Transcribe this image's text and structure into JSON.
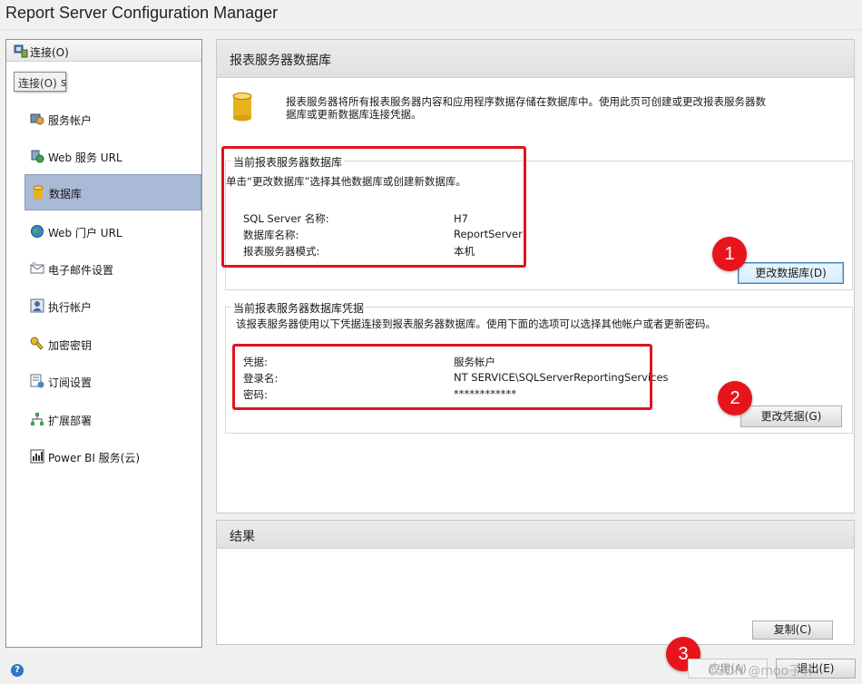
{
  "window": {
    "title": "Report Server Configuration Manager"
  },
  "sidebar": {
    "connect_label": "连接(O)",
    "tooltip": "连接(O)",
    "tooltip_tail": "s",
    "items": [
      {
        "label": "服务帐户",
        "icon": "service-account-icon"
      },
      {
        "label": "Web 服务 URL",
        "icon": "web-service-icon"
      },
      {
        "label": "数据库",
        "icon": "database-icon",
        "active": true
      },
      {
        "label": "Web 门户 URL",
        "icon": "web-portal-globe-icon"
      },
      {
        "label": "电子邮件设置",
        "icon": "email-icon"
      },
      {
        "label": "执行帐户",
        "icon": "execution-account-icon"
      },
      {
        "label": "加密密钥",
        "icon": "encryption-key-icon"
      },
      {
        "label": "订阅设置",
        "icon": "subscription-icon"
      },
      {
        "label": "扩展部署",
        "icon": "scale-out-icon"
      },
      {
        "label": "Power BI 服务(云)",
        "icon": "power-bi-icon"
      }
    ]
  },
  "main": {
    "header": "报表服务器数据库",
    "description_line1": "报表服务器将所有报表服务器内容和应用程序数据存储在数据库中。使用此页可创建或更改报表服务器数",
    "description_line2": "据库或更新数据库连接凭据。",
    "current_db": {
      "title": "当前报表服务器数据库",
      "hint": "单击“更改数据库”选择其他数据库或创建新数据库。",
      "rows": [
        {
          "label": "SQL Server 名称:",
          "value": "H7"
        },
        {
          "label": "数据库名称:",
          "value": "ReportServer"
        },
        {
          "label": "报表服务器模式:",
          "value": "本机"
        }
      ],
      "button": "更改数据库(D)"
    },
    "credentials": {
      "title": "当前报表服务器数据库凭据",
      "hint": "该报表服务器使用以下凭据连接到报表服务器数据库。使用下面的选项可以选择其他帐户或者更新密码。",
      "rows": [
        {
          "label": "凭据:",
          "value": "服务帐户"
        },
        {
          "label": "登录名:",
          "value": "NT SERVICE\\SQLServerReportingServices"
        },
        {
          "label": "密码:",
          "value": "************"
        }
      ],
      "button": "更改凭据(G)"
    },
    "results": {
      "header": "结果",
      "copy_button": "复制(C)"
    }
  },
  "badges": [
    "1",
    "2",
    "3"
  ],
  "footer": {
    "apply_button": "应用(A)",
    "exit_button": "退出(E)",
    "help_icon": "?"
  },
  "watermark": "CSDN @moo子轩",
  "colors": {
    "highlight_red": "#e0141e",
    "active_nav": "#a9b9d6"
  }
}
